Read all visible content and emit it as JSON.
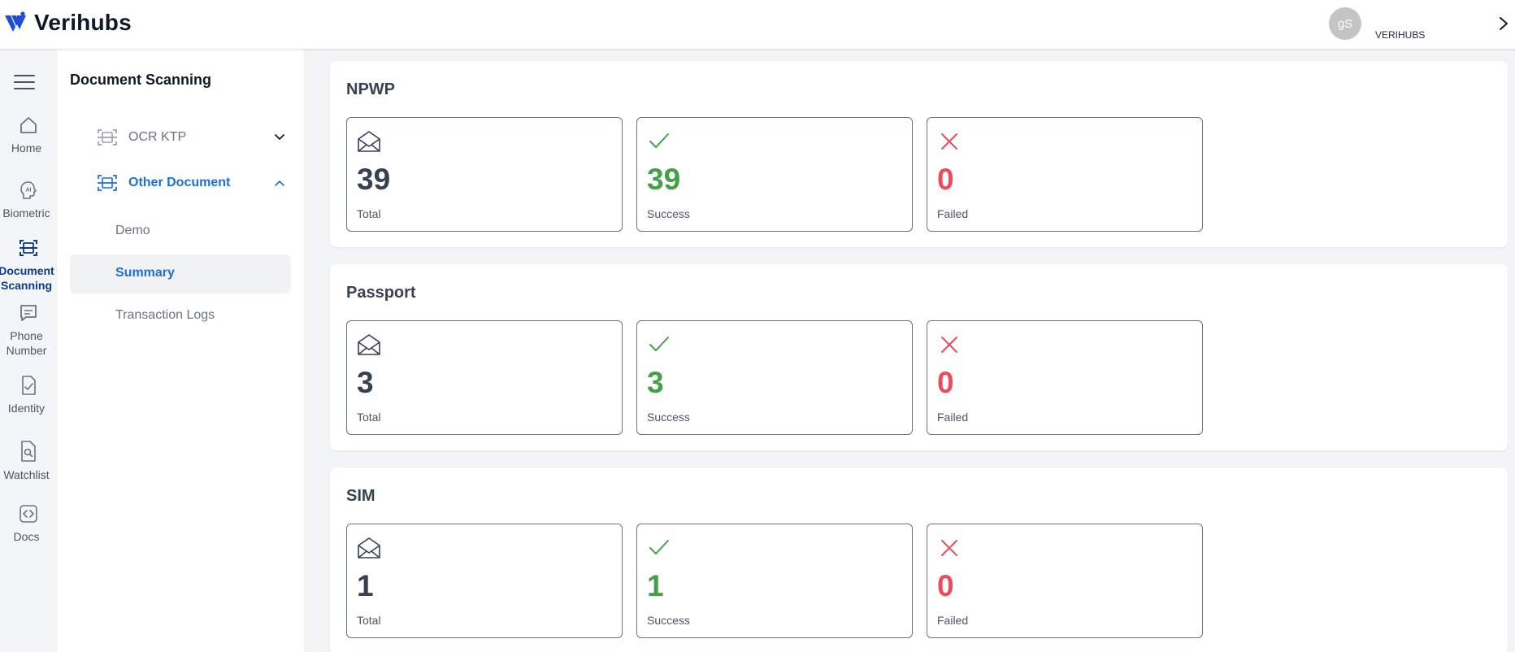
{
  "app": {
    "brand": "Verihubs",
    "user_initials": "gS",
    "org_name": "VERIHUBS"
  },
  "colors": {
    "accent": "#1d6fe0",
    "nav_active": "#0b3a8f",
    "success": "#43a047",
    "failed": "#ee4b5c"
  },
  "rail": {
    "items": [
      {
        "label": "Home",
        "icon": "home-icon"
      },
      {
        "label": "Biometric",
        "icon": "ai-face-icon"
      },
      {
        "label": "Document Scanning",
        "line1": "Document",
        "line2": "Scanning",
        "icon": "document-scan-icon",
        "active": true
      },
      {
        "label": "Phone Number",
        "line1": "Phone",
        "line2": "Number",
        "icon": "message-icon"
      },
      {
        "label": "Identity",
        "icon": "identity-check-icon"
      },
      {
        "label": "Watchlist",
        "icon": "watchlist-search-icon"
      },
      {
        "label": "Docs",
        "icon": "code-icon"
      }
    ]
  },
  "submenu": {
    "title": "Document Scanning",
    "groups": [
      {
        "label": "OCR KTP",
        "expanded": false
      },
      {
        "label": "Other Document",
        "expanded": true
      }
    ],
    "items": [
      {
        "label": "Demo"
      },
      {
        "label": "Summary",
        "active": true
      },
      {
        "label": "Transaction Logs"
      }
    ]
  },
  "panels": [
    {
      "title": "NPWP",
      "stats": [
        {
          "value": "39",
          "caption": "Total"
        },
        {
          "value": "39",
          "caption": "Success"
        },
        {
          "value": "0",
          "caption": "Failed"
        }
      ]
    },
    {
      "title": "Passport",
      "stats": [
        {
          "value": "3",
          "caption": "Total"
        },
        {
          "value": "3",
          "caption": "Success"
        },
        {
          "value": "0",
          "caption": "Failed"
        }
      ]
    },
    {
      "title": "SIM",
      "stats": [
        {
          "value": "1",
          "caption": "Total"
        },
        {
          "value": "1",
          "caption": "Success"
        },
        {
          "value": "0",
          "caption": "Failed"
        }
      ]
    }
  ]
}
